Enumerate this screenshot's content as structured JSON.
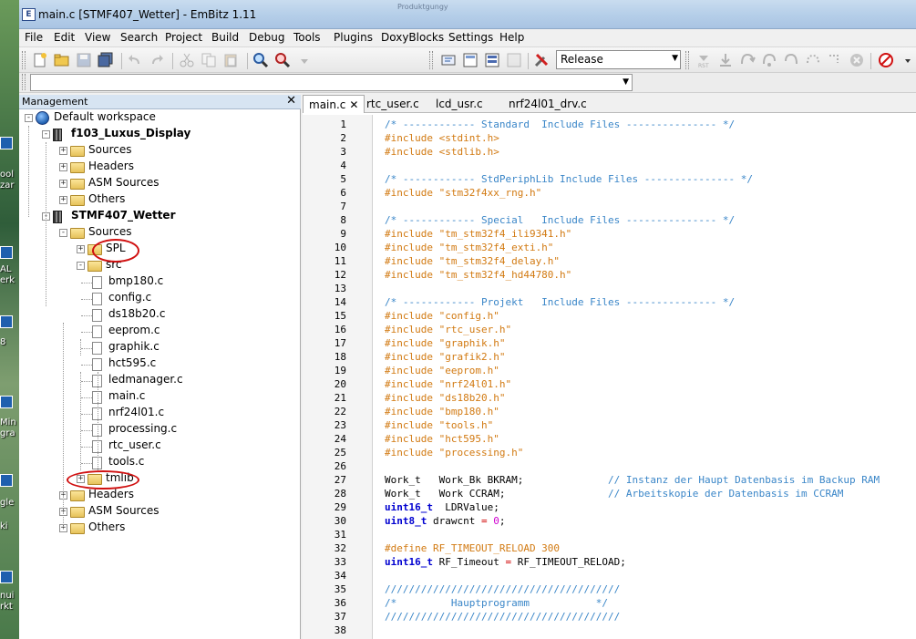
{
  "window": {
    "title": "main.c [STMF407_Wetter] - EmBitz 1.11",
    "ghost_text": "Produktgungy"
  },
  "desktop_labels": [
    "ool",
    "zar",
    "AL",
    "erk",
    "8",
    "Min",
    "gra",
    "gle",
    "ki",
    "nui",
    "rkt"
  ],
  "menu": [
    "File",
    "Edit",
    "View",
    "Search",
    "Project",
    "Build",
    "Debug",
    "Tools",
    "Plugins",
    "DoxyBlocks",
    "Settings",
    "Help"
  ],
  "toolbar": {
    "build_target": "Release"
  },
  "management": {
    "title": "Management",
    "tree": [
      {
        "id": "ws",
        "label": "Default workspace",
        "depth": 0,
        "type": "workspace",
        "toggle": "-"
      },
      {
        "id": "p1",
        "label": "f103_Luxus_Display",
        "depth": 1,
        "type": "project",
        "toggle": "-"
      },
      {
        "id": "p1s",
        "label": "Sources",
        "depth": 2,
        "type": "folder",
        "toggle": "+"
      },
      {
        "id": "p1h",
        "label": "Headers",
        "depth": 2,
        "type": "folder",
        "toggle": "+"
      },
      {
        "id": "p1a",
        "label": "ASM Sources",
        "depth": 2,
        "type": "folder",
        "toggle": "+"
      },
      {
        "id": "p1o",
        "label": "Others",
        "depth": 2,
        "type": "folder",
        "toggle": "+"
      },
      {
        "id": "p2",
        "label": "STMF407_Wetter",
        "depth": 1,
        "type": "project",
        "toggle": "-"
      },
      {
        "id": "p2s",
        "label": "Sources",
        "depth": 2,
        "type": "folder",
        "toggle": "-"
      },
      {
        "id": "spl",
        "label": "SPL",
        "depth": 3,
        "type": "folder",
        "toggle": "+"
      },
      {
        "id": "src",
        "label": "src",
        "depth": 3,
        "type": "folder",
        "toggle": "-"
      },
      {
        "id": "f1",
        "label": "bmp180.c",
        "depth": 4,
        "type": "file"
      },
      {
        "id": "f2",
        "label": "config.c",
        "depth": 4,
        "type": "file"
      },
      {
        "id": "f3",
        "label": "ds18b20.c",
        "depth": 4,
        "type": "file"
      },
      {
        "id": "f4",
        "label": "eeprom.c",
        "depth": 4,
        "type": "file"
      },
      {
        "id": "f5",
        "label": "graphik.c",
        "depth": 4,
        "type": "file"
      },
      {
        "id": "f6",
        "label": "hct595.c",
        "depth": 4,
        "type": "file"
      },
      {
        "id": "f7",
        "label": "ledmanager.c",
        "depth": 4,
        "type": "file"
      },
      {
        "id": "f8",
        "label": "main.c",
        "depth": 4,
        "type": "file"
      },
      {
        "id": "f9",
        "label": "nrf24l01.c",
        "depth": 4,
        "type": "file"
      },
      {
        "id": "f10",
        "label": "processing.c",
        "depth": 4,
        "type": "file"
      },
      {
        "id": "f11",
        "label": "rtc_user.c",
        "depth": 4,
        "type": "file"
      },
      {
        "id": "f12",
        "label": "tools.c",
        "depth": 4,
        "type": "file"
      },
      {
        "id": "tmlib",
        "label": "tmlib",
        "depth": 3,
        "type": "folder",
        "toggle": "+"
      },
      {
        "id": "p2h",
        "label": "Headers",
        "depth": 2,
        "type": "folder",
        "toggle": "+"
      },
      {
        "id": "p2a",
        "label": "ASM Sources",
        "depth": 2,
        "type": "folder",
        "toggle": "+"
      },
      {
        "id": "p2o",
        "label": "Others",
        "depth": 2,
        "type": "folder",
        "toggle": "+"
      }
    ]
  },
  "editor": {
    "tabs": [
      {
        "label": "main.c",
        "active": true
      },
      {
        "label": "rtc_user.c",
        "active": false
      },
      {
        "label": "lcd_usr.c",
        "active": false
      },
      {
        "label": "nrf24l01_drv.c",
        "active": false
      }
    ],
    "lines": [
      {
        "n": "1",
        "parts": [
          [
            "c-comment",
            "/* ------------ Standard  Include Files --------------- */"
          ]
        ]
      },
      {
        "n": "2",
        "parts": [
          [
            "c-pre",
            "#include <stdint.h>"
          ]
        ]
      },
      {
        "n": "3",
        "parts": [
          [
            "c-pre",
            "#include <stdlib.h>"
          ]
        ]
      },
      {
        "n": "4",
        "parts": []
      },
      {
        "n": "5",
        "parts": [
          [
            "c-comment",
            "/* ------------ StdPeriphLib Include Files --------------- */"
          ]
        ]
      },
      {
        "n": "6",
        "parts": [
          [
            "c-pre",
            "#include \"stm32f4xx_rng.h\""
          ]
        ]
      },
      {
        "n": "7",
        "parts": []
      },
      {
        "n": "8",
        "parts": [
          [
            "c-comment",
            "/* ------------ Special   Include Files --------------- */"
          ]
        ]
      },
      {
        "n": "9",
        "parts": [
          [
            "c-pre",
            "#include \"tm_stm32f4_ili9341.h\""
          ]
        ]
      },
      {
        "n": "10",
        "parts": [
          [
            "c-pre",
            "#include \"tm_stm32f4_exti.h\""
          ]
        ]
      },
      {
        "n": "11",
        "parts": [
          [
            "c-pre",
            "#include \"tm_stm32f4_delay.h\""
          ]
        ]
      },
      {
        "n": "12",
        "parts": [
          [
            "c-pre",
            "#include \"tm_stm32f4_hd44780.h\""
          ]
        ]
      },
      {
        "n": "13",
        "parts": []
      },
      {
        "n": "14",
        "parts": [
          [
            "c-comment",
            "/* ------------ Projekt   Include Files --------------- */"
          ]
        ]
      },
      {
        "n": "15",
        "parts": [
          [
            "c-pre",
            "#include \"config.h\""
          ]
        ]
      },
      {
        "n": "16",
        "parts": [
          [
            "c-pre",
            "#include \"rtc_user.h\""
          ]
        ]
      },
      {
        "n": "17",
        "parts": [
          [
            "c-pre",
            "#include \"graphik.h\""
          ]
        ]
      },
      {
        "n": "18",
        "parts": [
          [
            "c-pre",
            "#include \"grafik2.h\""
          ]
        ]
      },
      {
        "n": "19",
        "parts": [
          [
            "c-pre",
            "#include \"eeprom.h\""
          ]
        ]
      },
      {
        "n": "20",
        "parts": [
          [
            "c-pre",
            "#include \"nrf24l01.h\""
          ]
        ]
      },
      {
        "n": "21",
        "parts": [
          [
            "c-pre",
            "#include \"ds18b20.h\""
          ]
        ]
      },
      {
        "n": "22",
        "parts": [
          [
            "c-pre",
            "#include \"bmp180.h\""
          ]
        ]
      },
      {
        "n": "23",
        "parts": [
          [
            "c-pre",
            "#include \"tools.h\""
          ]
        ]
      },
      {
        "n": "24",
        "parts": [
          [
            "c-pre",
            "#include \"hct595.h\""
          ]
        ]
      },
      {
        "n": "25",
        "parts": [
          [
            "c-pre",
            "#include \"processing.h\""
          ]
        ]
      },
      {
        "n": "26",
        "parts": []
      },
      {
        "n": "27",
        "parts": [
          [
            "c-norm",
            "Work_t   Work_Bk BKRAM;              "
          ],
          [
            "c-comment",
            "// Instanz der Haupt Datenbasis im Backup RAM"
          ]
        ]
      },
      {
        "n": "28",
        "parts": [
          [
            "c-norm",
            "Work_t   Work CCRAM;                 "
          ],
          [
            "c-comment",
            "// Arbeitskopie der Datenbasis im CCRAM"
          ]
        ]
      },
      {
        "n": "29",
        "parts": [
          [
            "c-kw",
            "uint16_t"
          ],
          [
            "c-norm",
            "  LDRValue;"
          ]
        ]
      },
      {
        "n": "30",
        "parts": [
          [
            "c-kw",
            "uint8_t"
          ],
          [
            "c-norm",
            " drawcnt "
          ],
          [
            "c-op",
            "="
          ],
          [
            "c-norm",
            " "
          ],
          [
            "c-num",
            "0"
          ],
          [
            "c-norm",
            ";"
          ]
        ]
      },
      {
        "n": "31",
        "parts": []
      },
      {
        "n": "32",
        "parts": [
          [
            "c-pre",
            "#define RF_TIMEOUT_RELOAD 300"
          ]
        ]
      },
      {
        "n": "33",
        "parts": [
          [
            "c-kw",
            "uint16_t"
          ],
          [
            "c-norm",
            " RF_Timeout "
          ],
          [
            "c-op",
            "="
          ],
          [
            "c-norm",
            " RF_TIMEOUT_RELOAD;"
          ]
        ]
      },
      {
        "n": "34",
        "parts": []
      },
      {
        "n": "35",
        "parts": [
          [
            "c-comment",
            "///////////////////////////////////////"
          ]
        ]
      },
      {
        "n": "36",
        "parts": [
          [
            "c-comment",
            "/*         Hauptprogramm           */"
          ]
        ]
      },
      {
        "n": "37",
        "parts": [
          [
            "c-comment",
            "///////////////////////////////////////"
          ]
        ]
      },
      {
        "n": "38",
        "parts": []
      }
    ]
  }
}
